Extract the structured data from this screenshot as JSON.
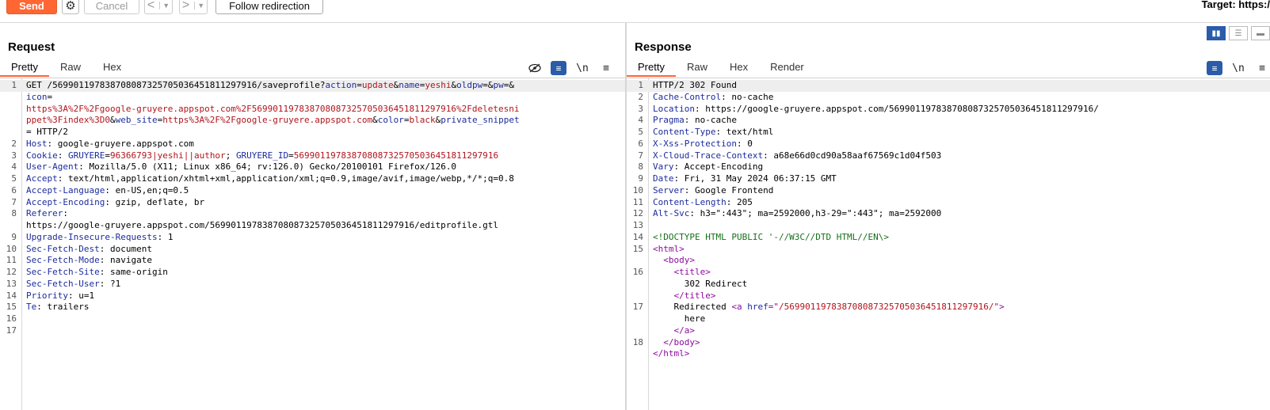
{
  "toolbar": {
    "send": "Send",
    "cancel": "Cancel",
    "back": "<",
    "forward": ">",
    "follow": "Follow redirection",
    "target": "Target: https:/"
  },
  "request": {
    "title": "Request",
    "tabs": [
      "Pretty",
      "Raw",
      "Hex"
    ],
    "lines": [
      {
        "n": "1",
        "parts": [
          [
            "",
            "GET /569901197838708087325705036451811297916/saveprofile?"
          ],
          [
            "hdr",
            "action"
          ],
          [
            "",
            "="
          ],
          [
            "red",
            "update"
          ],
          [
            "",
            "&"
          ],
          [
            "hdr",
            "name"
          ],
          [
            "",
            "="
          ],
          [
            "red",
            "yeshi"
          ],
          [
            "",
            "&"
          ],
          [
            "hdr",
            "oldpw"
          ],
          [
            "",
            "=&"
          ],
          [
            "hdr",
            "pw"
          ],
          [
            "",
            "=&"
          ]
        ]
      },
      {
        "n": "",
        "parts": [
          [
            "hdr",
            "icon"
          ],
          [
            "",
            "="
          ]
        ]
      },
      {
        "n": "",
        "parts": [
          [
            "red",
            "https%3A%2F%2Fgoogle-gruyere.appspot.com%2F569901197838708087325705036451811297916%2Fdeletesni"
          ]
        ]
      },
      {
        "n": "",
        "parts": [
          [
            "red",
            "ppet%3Findex%3D0"
          ],
          [
            "",
            "&"
          ],
          [
            "hdr",
            "web_site"
          ],
          [
            "",
            "="
          ],
          [
            "red",
            "https%3A%2F%2Fgoogle-gruyere.appspot.com"
          ],
          [
            "",
            "&"
          ],
          [
            "hdr",
            "color"
          ],
          [
            "",
            "="
          ],
          [
            "red",
            "black"
          ],
          [
            "",
            "&"
          ],
          [
            "hdr",
            "private_snippet"
          ]
        ]
      },
      {
        "n": "",
        "parts": [
          [
            "",
            "= HTTP/2"
          ]
        ]
      },
      {
        "n": "2",
        "parts": [
          [
            "hdr",
            "Host"
          ],
          [
            "",
            ": google-gruyere.appspot.com"
          ]
        ]
      },
      {
        "n": "3",
        "parts": [
          [
            "hdr",
            "Cookie"
          ],
          [
            "",
            ": "
          ],
          [
            "hdr",
            "GRUYERE"
          ],
          [
            "",
            "="
          ],
          [
            "red",
            "96366793|yeshi||author"
          ],
          [
            "",
            "; "
          ],
          [
            "hdr",
            "GRUYERE_ID"
          ],
          [
            "",
            "="
          ],
          [
            "red",
            "569901197838708087325705036451811297916"
          ]
        ]
      },
      {
        "n": "4",
        "parts": [
          [
            "hdr",
            "User-Agent"
          ],
          [
            "",
            ": Mozilla/5.0 (X11; Linux x86_64; rv:126.0) Gecko/20100101 Firefox/126.0"
          ]
        ]
      },
      {
        "n": "5",
        "parts": [
          [
            "hdr",
            "Accept"
          ],
          [
            "",
            ": text/html,application/xhtml+xml,application/xml;q=0.9,image/avif,image/webp,*/*;q=0.8"
          ]
        ]
      },
      {
        "n": "6",
        "parts": [
          [
            "hdr",
            "Accept-Language"
          ],
          [
            "",
            ": en-US,en;q=0.5"
          ]
        ]
      },
      {
        "n": "7",
        "parts": [
          [
            "hdr",
            "Accept-Encoding"
          ],
          [
            "",
            ": gzip, deflate, br"
          ]
        ]
      },
      {
        "n": "8",
        "parts": [
          [
            "hdr",
            "Referer"
          ],
          [
            "",
            ":"
          ]
        ]
      },
      {
        "n": "",
        "parts": [
          [
            "",
            "https://google-gruyere.appspot.com/569901197838708087325705036451811297916/editprofile.gtl"
          ]
        ]
      },
      {
        "n": "9",
        "parts": [
          [
            "hdr",
            "Upgrade-Insecure-Requests"
          ],
          [
            "",
            ": 1"
          ]
        ]
      },
      {
        "n": "10",
        "parts": [
          [
            "hdr",
            "Sec-Fetch-Dest"
          ],
          [
            "",
            ": document"
          ]
        ]
      },
      {
        "n": "11",
        "parts": [
          [
            "hdr",
            "Sec-Fetch-Mode"
          ],
          [
            "",
            ": navigate"
          ]
        ]
      },
      {
        "n": "12",
        "parts": [
          [
            "hdr",
            "Sec-Fetch-Site"
          ],
          [
            "",
            ": same-origin"
          ]
        ]
      },
      {
        "n": "13",
        "parts": [
          [
            "hdr",
            "Sec-Fetch-User"
          ],
          [
            "",
            ": ?1"
          ]
        ]
      },
      {
        "n": "14",
        "parts": [
          [
            "hdr",
            "Priority"
          ],
          [
            "",
            ": u=1"
          ]
        ]
      },
      {
        "n": "15",
        "parts": [
          [
            "hdr",
            "Te"
          ],
          [
            "",
            ": trailers"
          ]
        ]
      },
      {
        "n": "16",
        "parts": []
      },
      {
        "n": "17",
        "parts": []
      }
    ]
  },
  "response": {
    "title": "Response",
    "tabs": [
      "Pretty",
      "Raw",
      "Hex",
      "Render"
    ],
    "lines": [
      {
        "n": "1",
        "parts": [
          [
            "",
            "HTTP/2 302 Found"
          ]
        ]
      },
      {
        "n": "2",
        "parts": [
          [
            "hdr",
            "Cache-Control"
          ],
          [
            "",
            ": no-cache"
          ]
        ]
      },
      {
        "n": "3",
        "parts": [
          [
            "hdr",
            "Location"
          ],
          [
            "",
            ": https://google-gruyere.appspot.com/569901197838708087325705036451811297916/"
          ]
        ]
      },
      {
        "n": "4",
        "parts": [
          [
            "hdr",
            "Pragma"
          ],
          [
            "",
            ": no-cache"
          ]
        ]
      },
      {
        "n": "5",
        "parts": [
          [
            "hdr",
            "Content-Type"
          ],
          [
            "",
            ": text/html"
          ]
        ]
      },
      {
        "n": "6",
        "parts": [
          [
            "hdr",
            "X-Xss-Protection"
          ],
          [
            "",
            ": 0"
          ]
        ]
      },
      {
        "n": "7",
        "parts": [
          [
            "hdr",
            "X-Cloud-Trace-Context"
          ],
          [
            "",
            ": a68e66d0cd90a58aaf67569c1d04f503"
          ]
        ]
      },
      {
        "n": "8",
        "parts": [
          [
            "hdr",
            "Vary"
          ],
          [
            "",
            ": Accept-Encoding"
          ]
        ]
      },
      {
        "n": "9",
        "parts": [
          [
            "hdr",
            "Date"
          ],
          [
            "",
            ": Fri, 31 May 2024 06:37:15 GMT"
          ]
        ]
      },
      {
        "n": "10",
        "parts": [
          [
            "hdr",
            "Server"
          ],
          [
            "",
            ": Google Frontend"
          ]
        ]
      },
      {
        "n": "11",
        "parts": [
          [
            "hdr",
            "Content-Length"
          ],
          [
            "",
            ": 205"
          ]
        ]
      },
      {
        "n": "12",
        "parts": [
          [
            "hdr",
            "Alt-Svc"
          ],
          [
            "",
            ": h3=\":443\"; ma=2592000,h3-29=\":443\"; ma=2592000"
          ]
        ]
      },
      {
        "n": "13",
        "parts": []
      },
      {
        "n": "14",
        "parts": [
          [
            "cmt",
            "<!DOCTYPE HTML PUBLIC '-//W3C//DTD HTML//EN\\>"
          ]
        ]
      },
      {
        "n": "15",
        "parts": [
          [
            "tag",
            "<html>"
          ]
        ]
      },
      {
        "n": "",
        "parts": [
          [
            "",
            "  "
          ],
          [
            "tag",
            "<body>"
          ]
        ]
      },
      {
        "n": "16",
        "parts": [
          [
            "",
            "    "
          ],
          [
            "tag",
            "<title>"
          ]
        ]
      },
      {
        "n": "",
        "parts": [
          [
            "",
            "      302 Redirect"
          ]
        ]
      },
      {
        "n": "",
        "parts": [
          [
            "",
            "    "
          ],
          [
            "tag",
            "</title>"
          ]
        ]
      },
      {
        "n": "17",
        "parts": [
          [
            "",
            "    Redirected "
          ],
          [
            "tag",
            "<a "
          ],
          [
            "attr",
            "href"
          ],
          [
            "tag",
            "=\""
          ],
          [
            "red",
            "/569901197838708087325705036451811297916/"
          ],
          [
            "tag",
            "\">"
          ]
        ]
      },
      {
        "n": "",
        "parts": [
          [
            "",
            "      here"
          ]
        ]
      },
      {
        "n": "",
        "parts": [
          [
            "",
            "    "
          ],
          [
            "tag",
            "</a>"
          ]
        ]
      },
      {
        "n": "18",
        "parts": [
          [
            "",
            "  "
          ],
          [
            "tag",
            "</body>"
          ]
        ]
      },
      {
        "n": "",
        "parts": [
          [
            "tag",
            "</html>"
          ]
        ]
      }
    ]
  }
}
